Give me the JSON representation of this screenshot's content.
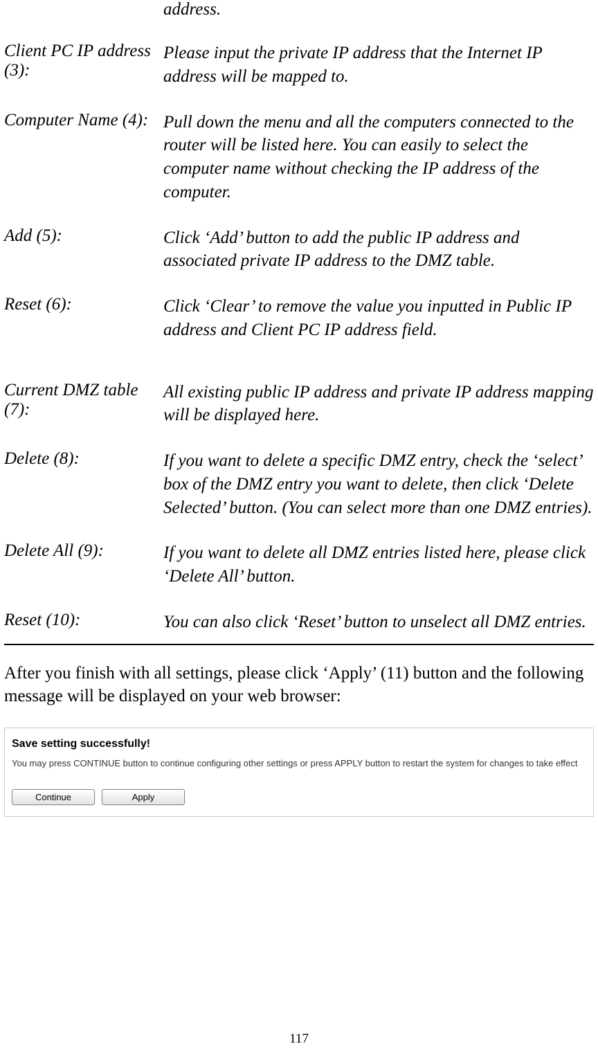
{
  "topFragment": "address.",
  "definitions": [
    {
      "term": "Client PC IP address (3):",
      "desc": "Please input the private IP address that the Internet IP address will be mapped to."
    },
    {
      "term": "Computer Name (4):",
      "desc": "Pull down the menu and all the computers connected to the router will be listed here. You can easily to select the computer name without checking the IP address of the computer."
    },
    {
      "term": "Add (5):",
      "desc": "Click ‘Add’ button to add the public IP address and associated private IP address to the DMZ table."
    },
    {
      "term": "Reset (6):",
      "desc": "Click ‘Clear’ to remove the value you inputted in Public IP address and Client PC IP address field.",
      "bigGap": true
    },
    {
      "term": "Current DMZ table (7):",
      "desc": "All existing public IP address and private IP address mapping will be displayed here."
    },
    {
      "term": "Delete (8):",
      "desc": "If you want to delete a specific DMZ entry, check the ‘select’ box of the DMZ entry you want to delete, then click ‘Delete Selected’ button. (You can select more than one DMZ entries)."
    },
    {
      "term": "Delete All (9):",
      "desc": "If you want to delete all DMZ entries listed here, please click ‘Delete All’ button."
    },
    {
      "term": "Reset (10):",
      "desc": "You can also click ‘Reset’ button to unselect all DMZ entries."
    }
  ],
  "afterText": "After you finish with all settings, please click ‘Apply’ (11) button and the following message will be displayed on your web browser:",
  "saveBox": {
    "title": "Save setting successfully!",
    "text": "You may press CONTINUE button to continue configuring other settings or press APPLY button to restart the system for changes to take effect",
    "continueLabel": "Continue",
    "applyLabel": "Apply"
  },
  "pageNumber": "117"
}
